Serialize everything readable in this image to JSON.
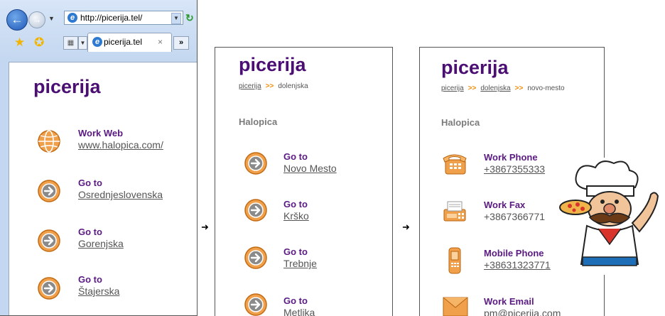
{
  "browser": {
    "url": "http://picerija.tel/",
    "tab_title": "picerija.tel",
    "tab_close": "×",
    "tab_more": "»"
  },
  "panel1": {
    "title": "picerija",
    "items": [
      {
        "label": "Work Web",
        "value": "www.halopica.com/"
      },
      {
        "label": "Go to",
        "value": "Osrednjeslovenska"
      },
      {
        "label": "Go to",
        "value": "Gorenjska"
      },
      {
        "label": "Go to",
        "value": "Štajerska"
      }
    ]
  },
  "panel2": {
    "title": "picerija",
    "crumbs": [
      "picerija",
      ">>",
      "dolenjska"
    ],
    "section": "Halopica",
    "items": [
      {
        "label": "Go to",
        "value": "Novo Mesto"
      },
      {
        "label": "Go to",
        "value": "Krško"
      },
      {
        "label": "Go to",
        "value": "Trebnje"
      },
      {
        "label": "Go to",
        "value": "Metlika"
      }
    ]
  },
  "panel3": {
    "title": "picerija",
    "crumbs": [
      "picerija",
      ">>",
      "dolenjska",
      ">>",
      "novo-mesto"
    ],
    "section": "Halopica",
    "items": [
      {
        "label": "Work Phone",
        "value": "+3867355333"
      },
      {
        "label": "Work Fax",
        "value": "+3867366771"
      },
      {
        "label": "Mobile Phone",
        "value": "+38631323771"
      },
      {
        "label": "Work Email",
        "value": "pm@picerija.com"
      }
    ]
  },
  "arrows": [
    "➜",
    "➜"
  ],
  "icons": {
    "back": "back-arrow-icon",
    "forward": "forward-arrow-icon",
    "globe": "globe-icon",
    "goto": "goto-arrow-icon",
    "phone": "phone-icon",
    "fax": "fax-icon",
    "mobile": "mobile-phone-icon",
    "email": "email-icon",
    "chef": "pizza-chef-illustration"
  },
  "colors": {
    "title": "#4b0f74",
    "label": "#5a1a82",
    "accent": "#f08a00"
  }
}
